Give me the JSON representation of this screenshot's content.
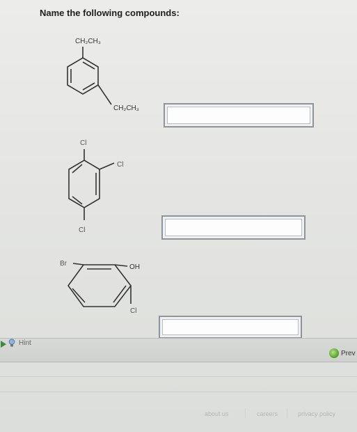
{
  "heading": "Name the following compounds:",
  "molecules": [
    {
      "id": "m1",
      "labels": {
        "top": "CH2CH3",
        "right": "CH2CH3"
      }
    },
    {
      "id": "m2",
      "labels": {
        "top": "Cl",
        "right": "Cl",
        "bottom": "Cl"
      }
    },
    {
      "id": "m3",
      "labels": {
        "left": "Br",
        "right": "OH",
        "bottom": "Cl"
      }
    }
  ],
  "answers": [
    {
      "value": "",
      "placeholder": ""
    },
    {
      "value": "",
      "placeholder": ""
    },
    {
      "value": "",
      "placeholder": ""
    }
  ],
  "hint": {
    "label": "Hint"
  },
  "nav": {
    "prev_label": "Prev"
  },
  "footer": {
    "links": [
      "about us",
      "careers",
      "privacy policy"
    ]
  },
  "colors": {
    "accent_green": "#5ea832",
    "field_border": "#8e949a"
  }
}
